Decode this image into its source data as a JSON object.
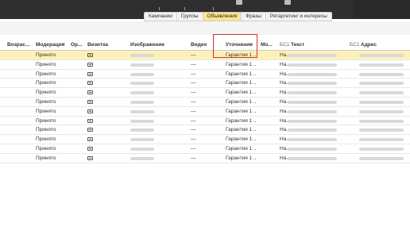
{
  "tabs": [
    {
      "label": "Кампании",
      "active": false
    },
    {
      "label": "Группы",
      "active": false
    },
    {
      "label": "Объявления",
      "active": true
    },
    {
      "label": "Фразы",
      "active": false
    },
    {
      "label": "Ретаргетинг и интересы",
      "active": false
    }
  ],
  "columns": {
    "age": "Возрас...",
    "moderation": "Модерация",
    "or": "Ор...",
    "vizitka": "Визитка",
    "image": "Изображение",
    "video": "Видео",
    "clarif": "Уточнения",
    "mo": "Мо...",
    "bc1_text_prefix": "БС1",
    "text": "Текст",
    "bc1_addr_prefix": "БС1",
    "address": "Адрес"
  },
  "rows": [
    {
      "moderation": "Принято",
      "video": "—",
      "clarif": "Гарантия 1 ...",
      "mo": "На..."
    },
    {
      "moderation": "Принято",
      "video": "—",
      "clarif": "Гарантия 1 ...",
      "mo": "На..."
    },
    {
      "moderation": "Принято",
      "video": "—",
      "clarif": "Гарантия 1 ...",
      "mo": "На..."
    },
    {
      "moderation": "Принято",
      "video": "—",
      "clarif": "Гарантия 1 ...",
      "mo": "На..."
    },
    {
      "moderation": "Принято",
      "video": "—",
      "clarif": "Гарантия 1 ...",
      "mo": "На..."
    },
    {
      "moderation": "Принято",
      "video": "—",
      "clarif": "Гарантия 1 ...",
      "mo": "На..."
    },
    {
      "moderation": "Принято",
      "video": "—",
      "clarif": "Гарантия 1 ...",
      "mo": "На..."
    },
    {
      "moderation": "Принято",
      "video": "—",
      "clarif": "Гарантия 1 ...",
      "mo": "На..."
    },
    {
      "moderation": "Принято",
      "video": "—",
      "clarif": "Гарантия 1 ...",
      "mo": "На..."
    },
    {
      "moderation": "Принято",
      "video": "—",
      "clarif": "Гарантия 1 ...",
      "mo": "На..."
    },
    {
      "moderation": "Принято",
      "video": "—",
      "clarif": "Гарантия 1 ...",
      "mo": "На..."
    },
    {
      "moderation": "Принято",
      "video": "—",
      "clarif": "Гарантия 1 ...",
      "mo": "На..."
    }
  ],
  "selected_row": 0,
  "colors": {
    "active_tab": "#fbe48e",
    "selected_row": "#fdf1b8",
    "highlight": "#d32f2f"
  }
}
